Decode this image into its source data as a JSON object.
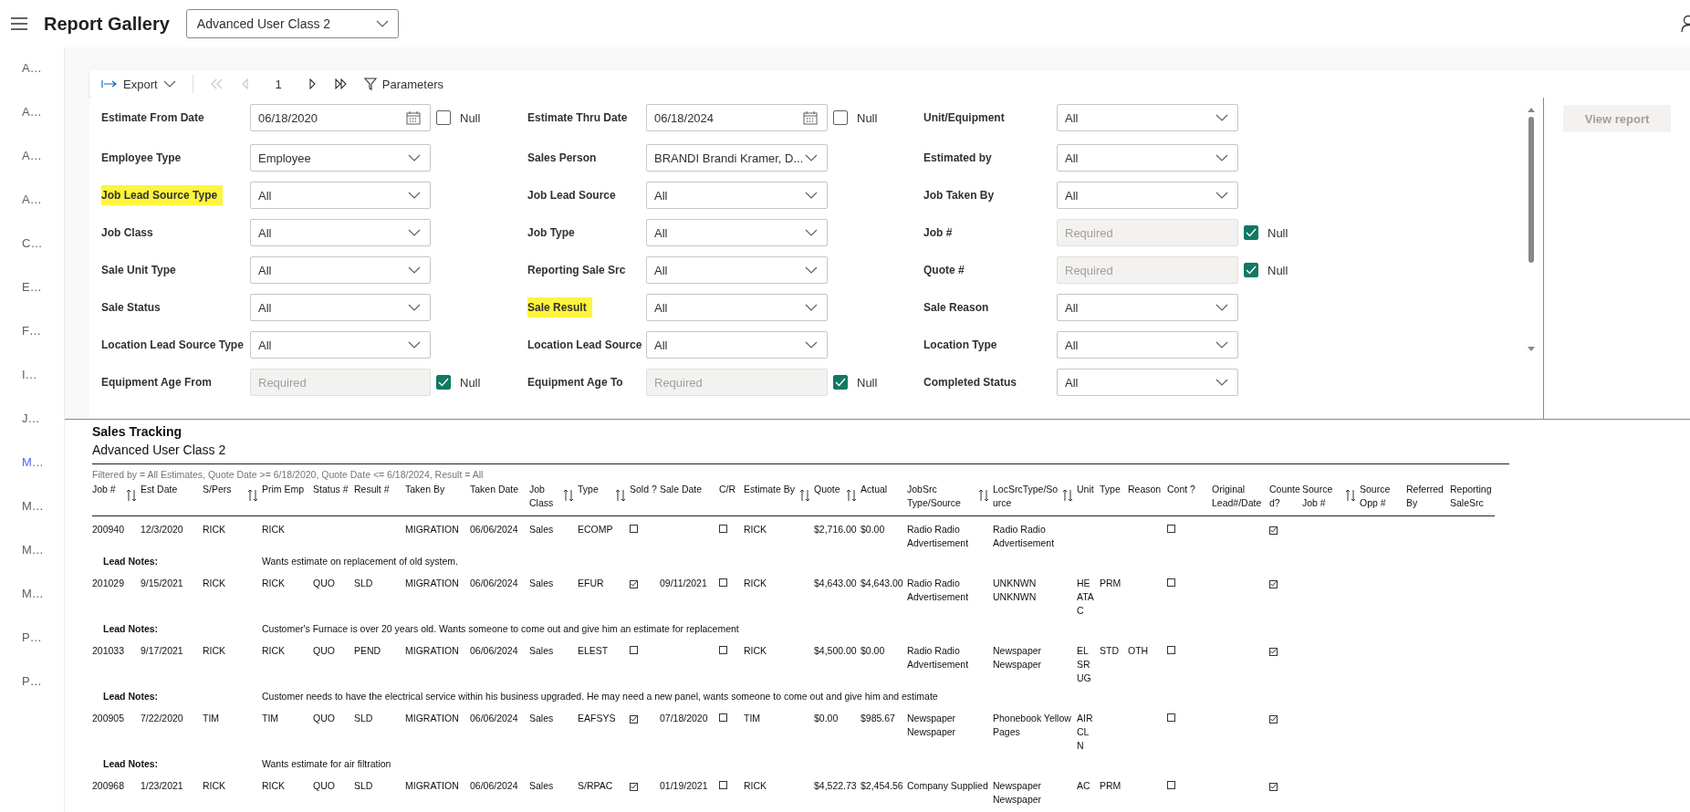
{
  "header": {
    "title": "Report Gallery",
    "report_select": "Advanced User Class 2"
  },
  "sidebar": {
    "items": [
      {
        "label": "A…",
        "selected": false
      },
      {
        "label": "A…",
        "selected": false
      },
      {
        "label": "A…",
        "selected": false
      },
      {
        "label": "A…",
        "selected": false
      },
      {
        "label": "C…",
        "selected": false
      },
      {
        "label": "E…",
        "selected": false
      },
      {
        "label": "F…",
        "selected": false
      },
      {
        "label": "I…",
        "selected": false
      },
      {
        "label": "J…",
        "selected": false
      },
      {
        "label": "M…",
        "selected": true
      },
      {
        "label": "M…",
        "selected": false
      },
      {
        "label": "M…",
        "selected": false
      },
      {
        "label": "M…",
        "selected": false
      },
      {
        "label": "P…",
        "selected": false
      },
      {
        "label": "P…",
        "selected": false
      }
    ]
  },
  "toolbar": {
    "export": "Export",
    "page": "1",
    "parameters": "Parameters",
    "first_disabled": true,
    "prev_disabled": true
  },
  "parameters": {
    "rows": [
      [
        {
          "label": "Estimate From Date",
          "kind": "date",
          "value": "06/18/2020",
          "disabled": false,
          "highlighted": false,
          "null_label": "Null",
          "null_checked": false
        },
        {
          "label": "Estimate Thru Date",
          "kind": "date",
          "value": "06/18/2024",
          "disabled": false,
          "highlighted": false,
          "null_label": "Null",
          "null_checked": false
        },
        {
          "label": "Unit/Equipment",
          "kind": "select",
          "value": "All",
          "disabled": false,
          "highlighted": false
        }
      ],
      [
        {
          "label": "Employee Type",
          "kind": "select",
          "value": "Employee",
          "disabled": false,
          "highlighted": false
        },
        {
          "label": "Sales Person",
          "kind": "select",
          "value": "BRANDI Brandi Kramer, D...",
          "disabled": false,
          "highlighted": false
        },
        {
          "label": "Estimated by",
          "kind": "select",
          "value": "All",
          "disabled": false,
          "highlighted": false
        }
      ],
      [
        {
          "label": "Job Lead Source Type",
          "kind": "select",
          "value": "All",
          "disabled": false,
          "highlighted": true
        },
        {
          "label": "Job Lead Source",
          "kind": "select",
          "value": "All",
          "disabled": false,
          "highlighted": false
        },
        {
          "label": "Job Taken By",
          "kind": "select",
          "value": "All",
          "disabled": false,
          "highlighted": false
        }
      ],
      [
        {
          "label": "Job Class",
          "kind": "select",
          "value": "All",
          "disabled": false,
          "highlighted": false
        },
        {
          "label": "Job Type",
          "kind": "select",
          "value": "All",
          "disabled": false,
          "highlighted": false
        },
        {
          "label": "Job #",
          "kind": "text",
          "placeholder": "Required",
          "disabled": true,
          "highlighted": false,
          "null_label": "Null",
          "null_checked": true
        }
      ],
      [
        {
          "label": "Sale Unit Type",
          "kind": "select",
          "value": "All",
          "disabled": false,
          "highlighted": false
        },
        {
          "label": "Reporting Sale Src",
          "kind": "select",
          "value": "All",
          "disabled": false,
          "highlighted": false
        },
        {
          "label": "Quote #",
          "kind": "text",
          "placeholder": "Required",
          "disabled": true,
          "highlighted": false,
          "null_label": "Null",
          "null_checked": true
        }
      ],
      [
        {
          "label": "Sale Status",
          "kind": "select",
          "value": "All",
          "disabled": false,
          "highlighted": false
        },
        {
          "label": "Sale Result",
          "kind": "select",
          "value": "All",
          "disabled": false,
          "highlighted": true
        },
        {
          "label": "Sale Reason",
          "kind": "select",
          "value": "All",
          "disabled": false,
          "highlighted": false
        }
      ],
      [
        {
          "label": "Location Lead Source Type",
          "kind": "select",
          "value": "All",
          "disabled": false,
          "highlighted": false
        },
        {
          "label": "Location Lead Source",
          "kind": "select",
          "value": "All",
          "disabled": false,
          "highlighted": false
        },
        {
          "label": "Location Type",
          "kind": "select",
          "value": "All",
          "disabled": false,
          "highlighted": false
        }
      ],
      [
        {
          "label": "Equipment Age From",
          "kind": "text",
          "placeholder": "Required",
          "disabled": true,
          "highlighted": false,
          "null_label": "Null",
          "null_checked": true
        },
        {
          "label": "Equipment Age To",
          "kind": "text",
          "placeholder": "Required",
          "disabled": true,
          "highlighted": false,
          "null_label": "Null",
          "null_checked": true
        },
        {
          "label": "Completed Status",
          "kind": "select",
          "value": "All",
          "disabled": false,
          "highlighted": false
        }
      ]
    ]
  },
  "view_report": {
    "label": "View report",
    "disabled": true
  },
  "report": {
    "title": "Sales Tracking",
    "subtitle": "Advanced User Class 2",
    "filter": "Filtered by = All Estimates, Quote Date >= 6/18/2020, Quote Date <= 6/18/2024, Result = All",
    "columns": [
      {
        "label": "Job #",
        "kind": "text",
        "sortable": true
      },
      {
        "label": "Est Date",
        "kind": "text",
        "sortable": false
      },
      {
        "label": "S/Pers",
        "kind": "text",
        "sortable": true
      },
      {
        "label": "Prim Emp",
        "kind": "text",
        "sortable": false
      },
      {
        "label": "Status #",
        "kind": "text",
        "sortable": false
      },
      {
        "label": "Result #",
        "kind": "text",
        "sortable": false
      },
      {
        "label": "Taken By",
        "kind": "text",
        "sortable": false
      },
      {
        "label": "Taken Date",
        "kind": "text",
        "sortable": false
      },
      {
        "label": "Job Class",
        "kind": "text",
        "sortable": true
      },
      {
        "label": "Type",
        "kind": "text",
        "sortable": true
      },
      {
        "label": "Sold ?",
        "kind": "check",
        "sortable": false
      },
      {
        "label": "Sale Date",
        "kind": "text",
        "sortable": false
      },
      {
        "label": "C/R",
        "kind": "check",
        "sortable": false
      },
      {
        "label": "Estimate By",
        "kind": "text",
        "sortable": true
      },
      {
        "label": "Quote",
        "kind": "text",
        "sortable": true
      },
      {
        "label": "Actual",
        "kind": "text",
        "sortable": false
      },
      {
        "label": "JobSrc Type/Source",
        "kind": "text",
        "sortable": true
      },
      {
        "label": "LocSrcType/Source",
        "kind": "text",
        "sortable": true
      },
      {
        "label": "Unit",
        "kind": "text",
        "sortable": false
      },
      {
        "label": "Type",
        "kind": "text",
        "sortable": false
      },
      {
        "label": "Reason",
        "kind": "text",
        "sortable": false
      },
      {
        "label": "Cont ?",
        "kind": "check",
        "sortable": false
      },
      {
        "label": "Original Lead#/Date",
        "kind": "text",
        "sortable": false
      },
      {
        "label": "Counted?",
        "kind": "check",
        "sortable": false
      },
      {
        "label": "Source Job #",
        "kind": "text",
        "sortable": true
      },
      {
        "label": "Source Opp #",
        "kind": "text",
        "sortable": false
      },
      {
        "label": "Referred By",
        "kind": "text",
        "sortable": false
      },
      {
        "label": "Reporting SaleSrc",
        "kind": "text",
        "sortable": false
      }
    ],
    "rows": [
      {
        "cells": [
          "200940",
          "12/3/2020",
          "RICK",
          "RICK",
          null,
          null,
          "MIGRATION",
          "06/06/2024",
          "Sales",
          "ECOMP",
          false,
          null,
          false,
          "RICK",
          "$2,716.00",
          "$0.00",
          "Radio Radio Advertisement",
          "Radio Radio Advertisement",
          null,
          null,
          null,
          false,
          null,
          true,
          null,
          null,
          null,
          null
        ],
        "notes_label": "Lead Notes:",
        "notes": "Wants estimate on replacement of old system."
      },
      {
        "cells": [
          "201029",
          "9/15/2021",
          "RICK",
          "RICK",
          "QUO",
          "SLD",
          "MIGRATION",
          "06/06/2024",
          "Sales",
          "EFUR",
          true,
          "09/11/2021",
          false,
          "RICK",
          "$4,643.00",
          "$4,643.00",
          "Radio Radio Advertisement",
          "UNKNWN UNKNWN",
          "HEATAC",
          "PRM",
          null,
          false,
          null,
          true,
          null,
          null,
          null,
          null
        ],
        "notes_label": "Lead Notes:",
        "notes": "Customer's Furnace is over 20 years old. Wants someone to come out and give him an estimate for replacement"
      },
      {
        "cells": [
          "201033",
          "9/17/2021",
          "RICK",
          "RICK",
          "QUO",
          "PEND",
          "MIGRATION",
          "06/06/2024",
          "Sales",
          "ELEST",
          false,
          null,
          false,
          "RICK",
          "$4,500.00",
          "$0.00",
          "Radio Radio Advertisement",
          "Newspaper Newspaper",
          "ELSRUG",
          "STD",
          "OTH",
          false,
          null,
          true,
          null,
          null,
          null,
          null
        ],
        "notes_label": "Lead Notes:",
        "notes": "Customer needs to have the electrical service within his business upgraded. He may need a new panel, wants someone to come out and give him and estimate"
      },
      {
        "cells": [
          "200905",
          "7/22/2020",
          "TIM",
          "TIM",
          "QUO",
          "SLD",
          "MIGRATION",
          "06/06/2024",
          "Sales",
          "EAFSYS",
          true,
          "07/18/2020",
          false,
          "TIM",
          "$0.00",
          "$985.67",
          "Newspaper Newspaper",
          "Phonebook Yellow Pages",
          "AIRCLN",
          null,
          null,
          false,
          null,
          true,
          null,
          null,
          null,
          null
        ],
        "notes_label": "Lead Notes:",
        "notes": "Wants estimate for air filtration"
      },
      {
        "cells": [
          "200968",
          "1/23/2021",
          "RICK",
          "RICK",
          "QUO",
          "SLD",
          "MIGRATION",
          "06/06/2024",
          "Sales",
          "S/RPAC",
          true,
          "01/19/2021",
          false,
          "RICK",
          "$4,522.73",
          "$2,454.56",
          "Company Supplied",
          "Newspaper Newspaper",
          "AC",
          "PRM",
          null,
          false,
          null,
          true,
          null,
          null,
          null,
          null
        ]
      }
    ]
  }
}
